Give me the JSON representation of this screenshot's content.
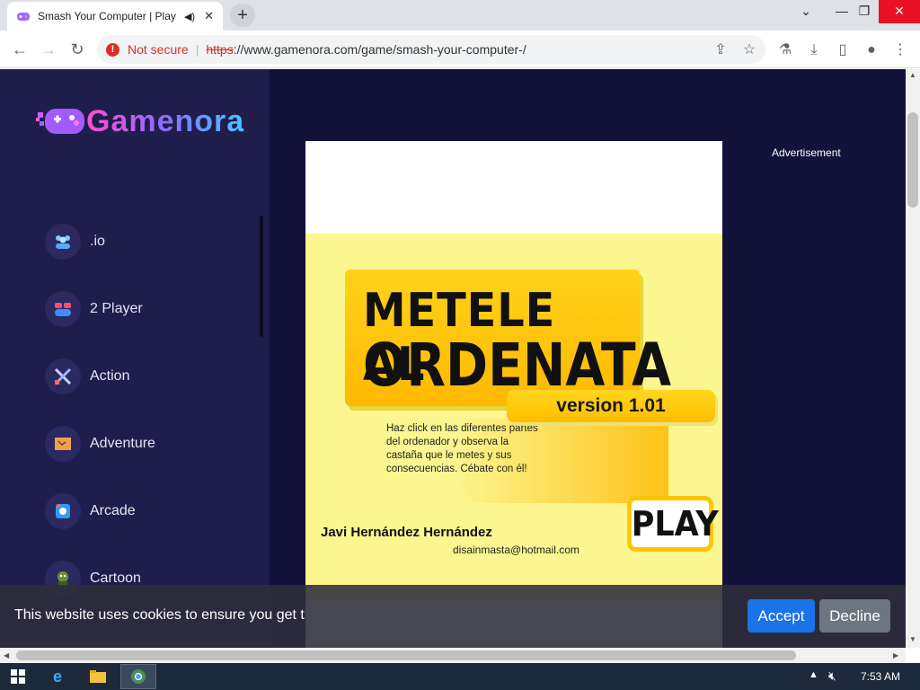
{
  "browser": {
    "tab_title": "Smash Your Computer | Play",
    "new_tab_label": "+",
    "url_status": "Not secure",
    "url_scheme": "https",
    "url_rest": "://www.gamenora.com/game/smash-your-computer-/"
  },
  "site": {
    "logo_text": "Gamenora",
    "categories": [
      {
        "label": ".io",
        "icon": "people-icon"
      },
      {
        "label": "2 Player",
        "icon": "gamepad-icon"
      },
      {
        "label": "Action",
        "icon": "swords-icon"
      },
      {
        "label": "Adventure",
        "icon": "map-icon"
      },
      {
        "label": "Arcade",
        "icon": "arcade-icon"
      },
      {
        "label": "Cartoon",
        "icon": "character-icon"
      }
    ],
    "advertisement_label": "Advertisement"
  },
  "game": {
    "title_line1": "METELE AL",
    "title_line2": "ORDENATA",
    "version": "version 1.01",
    "description": "Haz click en las diferentes partes del ordenador y observa la castaña que le metes y sus consecuencias. Cébate con él!",
    "author": "Javi Hernández Hernández",
    "email": "disainmasta@hotmail.com",
    "play_label": "PLAY"
  },
  "cookie_bar": {
    "text": "This website uses cookies to ensure you get the best experience on our website.",
    "accept_label": "Accept",
    "decline_label": "Decline"
  },
  "taskbar": {
    "time": "7:53 AM"
  }
}
